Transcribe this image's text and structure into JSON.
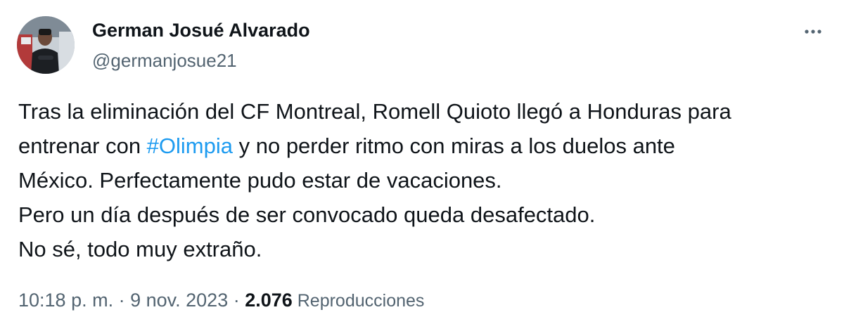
{
  "tweet": {
    "author": {
      "name": "German Josué Alvarado",
      "handle": "@germanjosue21"
    },
    "body": {
      "line1": "Tras la eliminación del CF Montreal, Romell Quioto llegó a Honduras para",
      "line2_before": "entrenar con ",
      "hashtag": "#Olimpia",
      "line2_after": " y no perder ritmo con miras a los duelos ante",
      "line3": "México. Perfectamente pudo estar de vacaciones.",
      "line4": "Pero un día después de ser convocado queda desafectado.",
      "line5": "No sé, todo muy extraño."
    },
    "meta": {
      "time": "10:18 p. m.",
      "separator": " · ",
      "date": "9 nov. 2023",
      "separator2": " · ",
      "views_count": "2.076",
      "views_label": " Reproducciones"
    },
    "icons": {
      "more": "more-horizontal-icon"
    },
    "colors": {
      "text": "#0f1419",
      "secondary": "#536471",
      "link": "#1d9bf0"
    }
  }
}
